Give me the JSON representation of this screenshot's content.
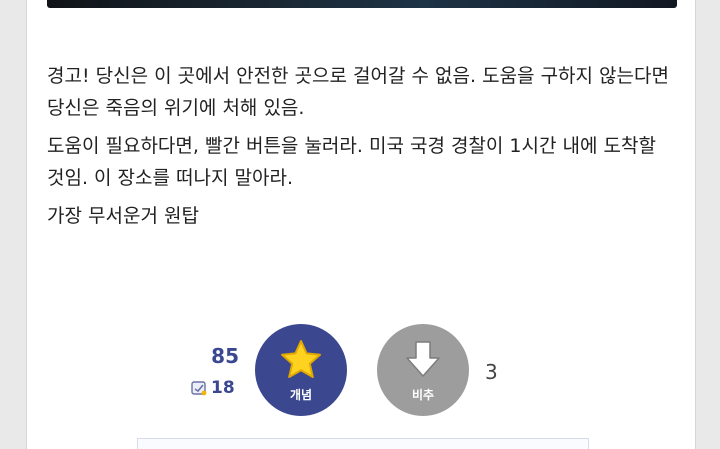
{
  "post": {
    "paragraphs": [
      "경고! 당신은 이 곳에서 안전한 곳으로 걸어갈 수 없음. 도움을 구하지 않는다면 당신은 죽음의 위기에 처해 있음.",
      "도움이 필요하다면, 빨간 버튼을 눌러라. 미국 국경 경찰이 1시간 내에 도착할 것임. 이 장소를 떠나지 말아라.",
      "가장 무서운거 원탑"
    ]
  },
  "recommend": {
    "upvote_count": "85",
    "fixed_upvote_count": "18",
    "upvote_label": "개념",
    "downvote_label": "비추",
    "downvote_count": "3",
    "upvote_color": "#3b4890",
    "downvote_color": "#9d9d9d",
    "star_color": "#ffd21f",
    "upvote_icon": "star-icon",
    "downvote_icon": "arrow-down-icon",
    "fixed_icon": "fixed-recommend-icon"
  }
}
